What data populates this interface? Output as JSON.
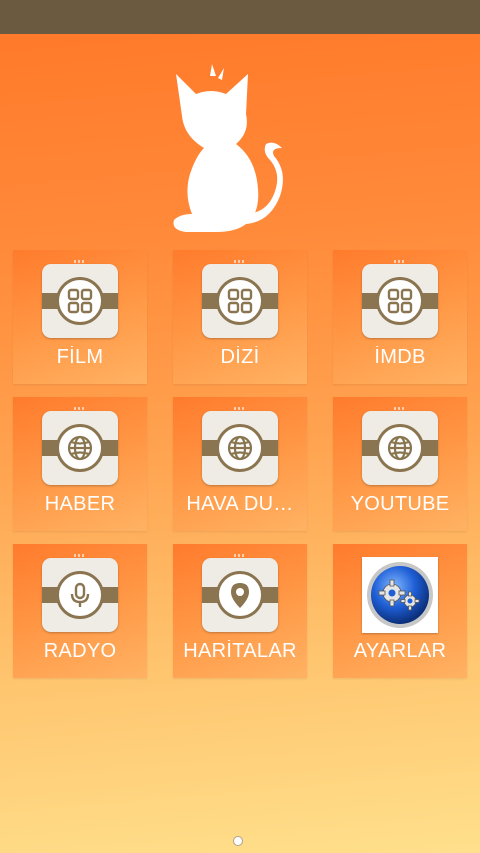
{
  "colors": {
    "status_bar": "#6b5a40",
    "accent_brown": "#8a7550",
    "tile_orange": "#ff8a3a",
    "gradient_bottom": "#ffe08c"
  },
  "logo": {
    "icon": "cat-silhouette-icon"
  },
  "apps": [
    {
      "label": "FİLM",
      "icon": "grid-apps-icon"
    },
    {
      "label": "DİZİ",
      "icon": "grid-apps-icon"
    },
    {
      "label": "İMDB",
      "icon": "grid-apps-icon"
    },
    {
      "label": "HABER",
      "icon": "globe-icon"
    },
    {
      "label": "HAVA DU…",
      "icon": "globe-icon"
    },
    {
      "label": "YOUTUBE",
      "icon": "globe-icon"
    },
    {
      "label": "RADYO",
      "icon": "microphone-icon"
    },
    {
      "label": "HARİTALAR",
      "icon": "map-pin-icon"
    },
    {
      "label": "AYARLAR",
      "icon": "settings-gears-icon"
    }
  ],
  "pager": {
    "current_page": 1,
    "pages": 1
  }
}
